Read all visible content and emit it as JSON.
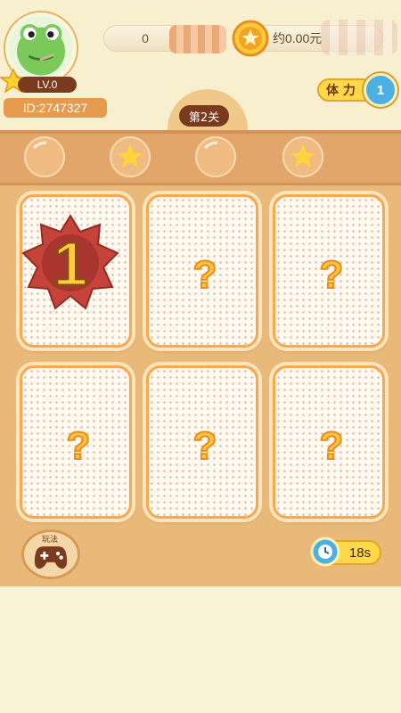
{
  "player": {
    "level": "LV.0",
    "id": "ID:2747327"
  },
  "currency": {
    "coins": "0",
    "money": "约0.00元"
  },
  "stamina": {
    "label": "体 力",
    "value": "1"
  },
  "stage": {
    "label": "第2关"
  },
  "board": {
    "revealed_number": "1",
    "hidden_symbol": "?"
  },
  "game_button": {
    "label": "玩法"
  },
  "timer": {
    "value": "18s"
  },
  "colors": {
    "accent": "#f7a852",
    "board": "#e9b979",
    "pill_dark": "#7a3a1d",
    "stamina_yellow": "#ffd84a",
    "reveal_red": "#c64339"
  }
}
